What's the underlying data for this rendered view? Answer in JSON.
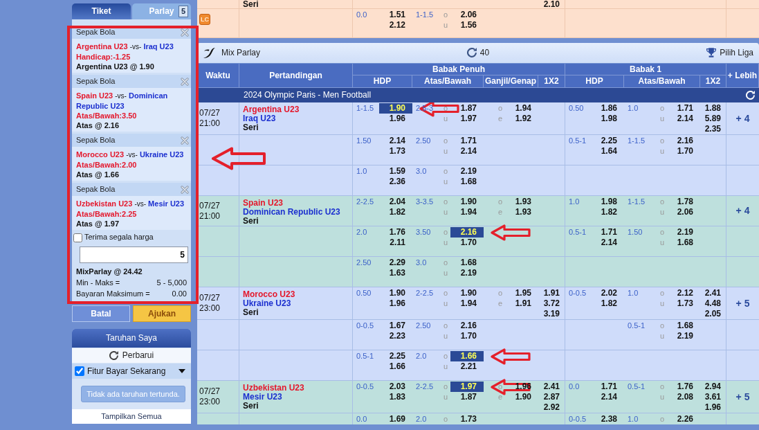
{
  "bet_slip": {
    "tabs": [
      {
        "label": "Tiket",
        "selected": false
      },
      {
        "label": "Parlay",
        "selected": true,
        "count": "5"
      }
    ],
    "selections": [
      {
        "sport": "Sepak Bola",
        "home": "Argentina U23",
        "separator": "-vs-",
        "away": "Iraq U23",
        "market": "Handicap:-1.25",
        "pick": "Argentina U23 @ 1.90"
      },
      {
        "sport": "Sepak Bola",
        "home": "Spain U23",
        "separator": "-vs-",
        "away": "Dominican Republic U23",
        "market": "Atas/Bawah:3.50",
        "pick": "Atas @ 2.16"
      },
      {
        "sport": "Sepak Bola",
        "home": "Morocco U23",
        "separator": "-vs-",
        "away": "Ukraine U23",
        "market": "Atas/Bawah:2.00",
        "pick": "Atas @ 1.66"
      },
      {
        "sport": "Sepak Bola",
        "home": "Uzbekistan U23",
        "separator": "-vs-",
        "away": "Mesir U23",
        "market": "Atas/Bawah:2.25",
        "pick": "Atas @ 1.97"
      }
    ],
    "accept_any_odds": {
      "label": "Terima segala harga",
      "checked": false
    },
    "stake": {
      "value": "5"
    },
    "total_odds": "MixParlay @ 24.42",
    "limits": [
      {
        "label": "Min - Maks =",
        "value": "5 - 5,000"
      },
      {
        "label": "Bayaran Maksimum =",
        "value": "0.00"
      }
    ],
    "buttons": [
      {
        "label": "Batal",
        "kind": "cancel"
      },
      {
        "label": "Ajukan",
        "kind": "submit"
      }
    ]
  },
  "my_bets": {
    "title": "Taruhan Saya",
    "refresh": "Perbarui",
    "pay_now": {
      "label": "Fitur Bayar Sekarang",
      "checked": true
    },
    "empty_message": "Tidak ada taruhan tertunda.",
    "show_all": "Tampilkan Semua"
  },
  "previous_event": {
    "lines": [
      {
        "draw": "Seri",
        "ft_1x2": {
          "odds": [
            "2.10"
          ],
          "selected": [
            false
          ]
        }
      },
      {
        "badge": "LC",
        "ft_hdp": {
          "line": "0.0",
          "odds": [
            "1.51",
            "2.12"
          ],
          "selected": [
            false,
            false
          ]
        },
        "ft_ou": {
          "line": "1-1.5",
          "sides": [
            "o",
            "u"
          ],
          "odds": [
            "2.06",
            "1.56"
          ],
          "selected": [
            false,
            false
          ]
        }
      }
    ]
  },
  "mix_parlay_bar": {
    "title": "Mix Parlay",
    "count": "40",
    "league_picker": "Pilih Liga"
  },
  "table": {
    "columns": [
      {
        "label": "Waktu"
      },
      {
        "label": "Pertandingan"
      },
      {
        "label": "Babak Penuh",
        "children": [
          "HDP",
          "Atas/Bawah",
          "Ganjil/Genap",
          "1X2"
        ]
      },
      {
        "label": "Babak 1",
        "children": [
          "HDP",
          "Atas/Bawah",
          "1X2"
        ]
      },
      {
        "label": "+ Lebih"
      }
    ],
    "league": "2024 Olympic Paris - Men Football",
    "matches": [
      {
        "date": "07/27",
        "time": "21:00",
        "home": "Argentina U23",
        "away": "Iraq U23",
        "draw": "Seri",
        "more": "+ 4",
        "lines": [
          {
            "ft_hdp": {
              "line": "1-1.5",
              "odds": [
                "1.90",
                "1.96"
              ],
              "selected": [
                true,
                false
              ]
            },
            "ft_ou": {
              "line": "2.5-3",
              "sides": [
                "o",
                "u"
              ],
              "odds": [
                "1.87",
                "1.97"
              ],
              "selected": [
                false,
                false
              ]
            },
            "ft_oe": {
              "sides": [
                "o",
                "e"
              ],
              "odds": [
                "1.94",
                "1.92"
              ],
              "selected": [
                false,
                false
              ]
            },
            "h1_hdp": {
              "line": "0.50",
              "odds": [
                "1.86",
                "1.98"
              ],
              "selected": [
                false,
                false
              ]
            },
            "h1_ou": {
              "line": "1.0",
              "sides": [
                "o",
                "u"
              ],
              "odds": [
                "1.71",
                "2.14"
              ],
              "selected": [
                false,
                false
              ]
            },
            "h1_1x2": {
              "odds": [
                "1.88",
                "5.89",
                "2.35"
              ],
              "selected": [
                false,
                false,
                false
              ]
            }
          },
          {
            "ft_hdp": {
              "line": "1.50",
              "odds": [
                "2.14",
                "1.73"
              ],
              "selected": [
                false,
                false
              ]
            },
            "ft_ou": {
              "line": "2.50",
              "sides": [
                "o",
                "u"
              ],
              "odds": [
                "1.71",
                "2.14"
              ],
              "selected": [
                false,
                false
              ]
            },
            "h1_hdp": {
              "line": "0.5-1",
              "odds": [
                "2.25",
                "1.64"
              ],
              "selected": [
                false,
                false
              ]
            },
            "h1_ou": {
              "line": "1-1.5",
              "sides": [
                "o",
                "u"
              ],
              "odds": [
                "2.16",
                "1.70"
              ],
              "selected": [
                false,
                false
              ]
            }
          },
          {
            "ft_hdp": {
              "line": "1.0",
              "odds": [
                "1.59",
                "2.36"
              ],
              "selected": [
                false,
                false
              ]
            },
            "ft_ou": {
              "line": "3.0",
              "sides": [
                "o",
                "u"
              ],
              "odds": [
                "2.19",
                "1.68"
              ],
              "selected": [
                false,
                false
              ]
            }
          }
        ]
      },
      {
        "date": "07/27",
        "time": "21:00",
        "home": "Spain U23",
        "away": "Dominican Republic U23",
        "draw": "Seri",
        "more": "+ 4",
        "lines": [
          {
            "ft_hdp": {
              "line": "2-2.5",
              "odds": [
                "2.04",
                "1.82"
              ],
              "selected": [
                false,
                false
              ]
            },
            "ft_ou": {
              "line": "3-3.5",
              "sides": [
                "o",
                "u"
              ],
              "odds": [
                "1.90",
                "1.94"
              ],
              "selected": [
                false,
                false
              ]
            },
            "ft_oe": {
              "sides": [
                "o",
                "e"
              ],
              "odds": [
                "1.93",
                "1.93"
              ],
              "selected": [
                false,
                false
              ]
            },
            "h1_hdp": {
              "line": "1.0",
              "odds": [
                "1.98",
                "1.82"
              ],
              "selected": [
                false,
                false
              ]
            },
            "h1_ou": {
              "line": "1-1.5",
              "sides": [
                "o",
                "u"
              ],
              "odds": [
                "1.78",
                "2.06"
              ],
              "selected": [
                false,
                false
              ]
            }
          },
          {
            "ft_hdp": {
              "line": "2.0",
              "odds": [
                "1.76",
                "2.11"
              ],
              "selected": [
                false,
                false
              ]
            },
            "ft_ou": {
              "line": "3.50",
              "sides": [
                "o",
                "u"
              ],
              "odds": [
                "2.16",
                "1.70"
              ],
              "selected": [
                true,
                false
              ]
            },
            "h1_hdp": {
              "line": "0.5-1",
              "odds": [
                "1.71",
                "2.14"
              ],
              "selected": [
                false,
                false
              ]
            },
            "h1_ou": {
              "line": "1.50",
              "sides": [
                "o",
                "u"
              ],
              "odds": [
                "2.19",
                "1.68"
              ],
              "selected": [
                false,
                false
              ]
            }
          },
          {
            "ft_hdp": {
              "line": "2.50",
              "odds": [
                "2.29",
                "1.63"
              ],
              "selected": [
                false,
                false
              ]
            },
            "ft_ou": {
              "line": "3.0",
              "sides": [
                "o",
                "u"
              ],
              "odds": [
                "1.68",
                "2.19"
              ],
              "selected": [
                false,
                false
              ]
            }
          }
        ]
      },
      {
        "date": "07/27",
        "time": "23:00",
        "home": "Morocco U23",
        "away": "Ukraine U23",
        "draw": "Seri",
        "more": "+ 5",
        "lines": [
          {
            "ft_hdp": {
              "line": "0.50",
              "odds": [
                "1.90",
                "1.96"
              ],
              "selected": [
                false,
                false
              ]
            },
            "ft_ou": {
              "line": "2-2.5",
              "sides": [
                "o",
                "u"
              ],
              "odds": [
                "1.90",
                "1.94"
              ],
              "selected": [
                false,
                false
              ]
            },
            "ft_oe": {
              "sides": [
                "o",
                "e"
              ],
              "odds": [
                "1.95",
                "1.91"
              ],
              "selected": [
                false,
                false
              ]
            },
            "ft_1x2": {
              "odds": [
                "1.91",
                "3.72",
                "3.19"
              ],
              "selected": [
                false,
                false,
                false
              ]
            },
            "h1_hdp": {
              "line": "0-0.5",
              "odds": [
                "2.02",
                "1.82"
              ],
              "selected": [
                false,
                false
              ]
            },
            "h1_ou": {
              "line": "1.0",
              "sides": [
                "o",
                "u"
              ],
              "odds": [
                "2.12",
                "1.73"
              ],
              "selected": [
                false,
                false
              ]
            },
            "h1_1x2": {
              "odds": [
                "2.41",
                "4.48",
                "2.05"
              ],
              "selected": [
                false,
                false,
                false
              ]
            }
          },
          {
            "ft_hdp": {
              "line": "0-0.5",
              "odds": [
                "1.67",
                "2.23"
              ],
              "selected": [
                false,
                false
              ]
            },
            "ft_ou": {
              "line": "2.50",
              "sides": [
                "o",
                "u"
              ],
              "odds": [
                "2.16",
                "1.70"
              ],
              "selected": [
                false,
                false
              ]
            },
            "h1_ou": {
              "line": "0.5-1",
              "sides": [
                "o",
                "u"
              ],
              "odds": [
                "1.68",
                "2.19"
              ],
              "selected": [
                false,
                false
              ]
            }
          },
          {
            "ft_hdp": {
              "line": "0.5-1",
              "odds": [
                "2.25",
                "1.66"
              ],
              "selected": [
                false,
                false
              ]
            },
            "ft_ou": {
              "line": "2.0",
              "sides": [
                "o",
                "u"
              ],
              "odds": [
                "1.66",
                "2.21"
              ],
              "selected": [
                true,
                false
              ]
            }
          }
        ]
      },
      {
        "date": "07/27",
        "time": "23:00",
        "home": "Uzbekistan U23",
        "away": "Mesir U23",
        "draw": "Seri",
        "more": "+ 5",
        "lines": [
          {
            "ft_hdp": {
              "line": "0-0.5",
              "odds": [
                "2.03",
                "1.83"
              ],
              "selected": [
                false,
                false
              ]
            },
            "ft_ou": {
              "line": "2-2.5",
              "sides": [
                "o",
                "u"
              ],
              "odds": [
                "1.97",
                "1.87"
              ],
              "selected": [
                true,
                false
              ]
            },
            "ft_oe": {
              "sides": [
                "o",
                "e"
              ],
              "odds": [
                "1.96",
                "1.90"
              ],
              "selected": [
                false,
                false
              ]
            },
            "ft_1x2": {
              "odds": [
                "2.41",
                "2.87",
                "2.92"
              ],
              "selected": [
                false,
                false,
                false
              ]
            },
            "h1_hdp": {
              "line": "0.0",
              "odds": [
                "1.71",
                "2.14"
              ],
              "selected": [
                false,
                false
              ]
            },
            "h1_ou": {
              "line": "0.5-1",
              "sides": [
                "o",
                "u"
              ],
              "odds": [
                "1.76",
                "2.08"
              ],
              "selected": [
                false,
                false
              ]
            },
            "h1_1x2": {
              "odds": [
                "2.94",
                "3.61",
                "1.96"
              ],
              "selected": [
                false,
                false,
                false
              ]
            }
          },
          {
            "ft_hdp": {
              "line": "0.0",
              "odds": [
                "1.69"
              ],
              "selected": [
                false
              ]
            },
            "ft_ou": {
              "line": "2.0",
              "sides": [
                "o"
              ],
              "odds": [
                "1.73"
              ],
              "selected": [
                false
              ]
            },
            "h1_hdp": {
              "line": "0-0.5",
              "odds": [
                "2.38"
              ],
              "selected": [
                false
              ]
            },
            "h1_ou": {
              "line": "1.0",
              "sides": [
                "o"
              ],
              "odds": [
                "2.26"
              ],
              "selected": [
                false
              ]
            }
          }
        ]
      }
    ]
  }
}
